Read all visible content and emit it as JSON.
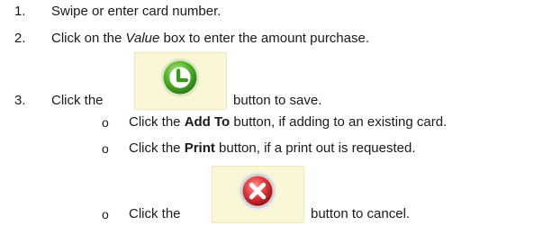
{
  "steps": [
    {
      "number": "1.",
      "text": "Swipe or enter card number."
    },
    {
      "number": "2.",
      "text_before": "Click on the ",
      "text_em": "Value",
      "text_after": " box to enter the amount purchase."
    },
    {
      "number": "3.",
      "text_before": "Click the ",
      "icon": "green-save-check-icon",
      "text_after": "button to save."
    }
  ],
  "sub_items": [
    {
      "bullet": "o",
      "text_before": "Click the ",
      "text_bold": "Add To",
      "text_after": " button, if adding to an existing card."
    },
    {
      "bullet": "o",
      "text_before": "Click the ",
      "text_bold": "Print",
      "text_after": " button, if a print out is requested."
    },
    {
      "bullet": "o",
      "text_before": "Click the ",
      "icon": "red-cancel-x-icon",
      "text_after": "button to cancel."
    }
  ],
  "colors": {
    "button_bg": "#fbf7d6",
    "save_green": "#3a9a1a",
    "cancel_red": "#d3262a"
  }
}
